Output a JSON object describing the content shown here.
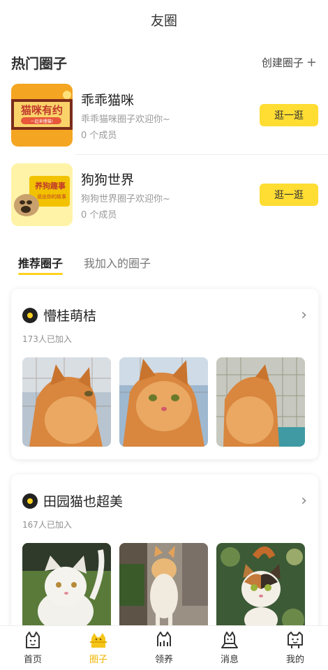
{
  "header": {
    "title": "友圈"
  },
  "hot": {
    "heading": "热门圈子",
    "create_label": "创建圈子",
    "create_plus": "+",
    "items": [
      {
        "name": "乖乖猫咪",
        "desc": "乖乖猫咪圈子欢迎你~",
        "members": "0 个成员",
        "button": "逛一逛",
        "thumb_text": "猫咪有约",
        "thumb_sub": "一起来撸猫!"
      },
      {
        "name": "狗狗世界",
        "desc": "狗狗世界圈子欢迎你~",
        "members": "0 个成员",
        "button": "逛一逛",
        "thumb_text": "养狗趣事",
        "thumb_sub": "说出你的故事"
      }
    ]
  },
  "tabs": [
    {
      "label": "推荐圈子",
      "active": true
    },
    {
      "label": "我加入的圈子",
      "active": false
    }
  ],
  "cards": [
    {
      "title": "懵桂萌桔",
      "joined": "173人已加入"
    },
    {
      "title": "田园猫也超美",
      "joined": "167人已加入"
    }
  ],
  "tabbar": [
    {
      "label": "首页",
      "icon": "cat-face-icon",
      "active": false
    },
    {
      "label": "圈子",
      "icon": "circle-group-icon",
      "active": true
    },
    {
      "label": "领养",
      "icon": "adopt-cat-icon",
      "active": false
    },
    {
      "label": "消息",
      "icon": "message-cat-icon",
      "active": false
    },
    {
      "label": "我的",
      "icon": "profile-cat-icon",
      "active": false
    }
  ],
  "colors": {
    "accent": "#ffdd33",
    "active_tab": "#f0b400",
    "muted": "#9a9a9a"
  }
}
